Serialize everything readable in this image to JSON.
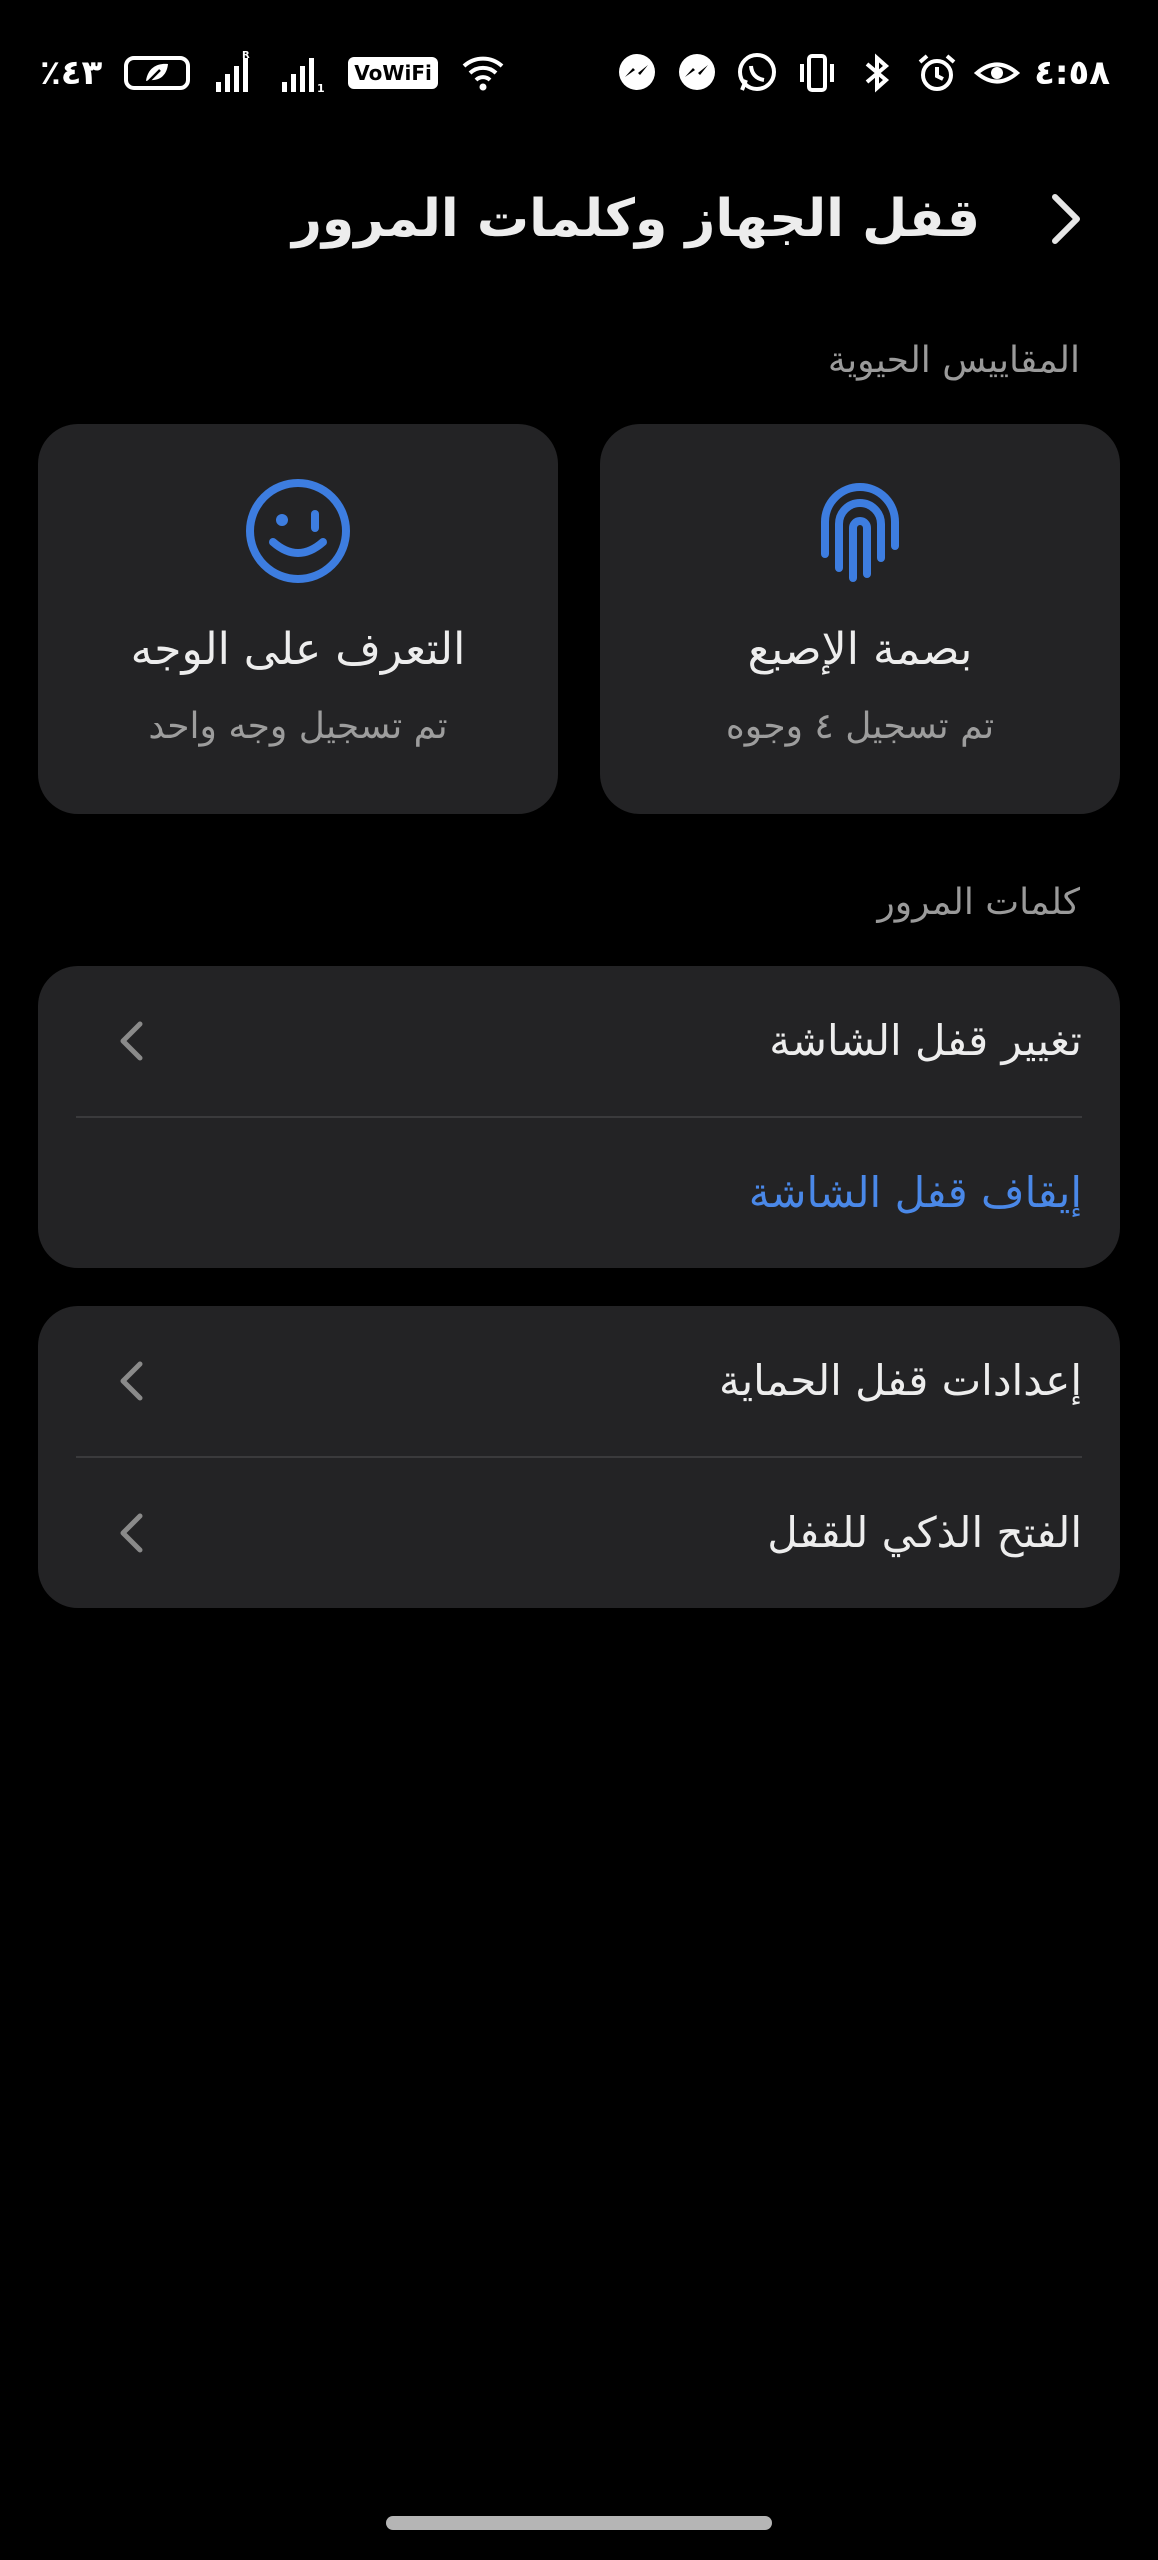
{
  "status_bar": {
    "time": "٤:٥٨",
    "battery_percent": "٪٤٣",
    "wifi_calling_label": "VoWiFi"
  },
  "header": {
    "title": "قفل الجهاز وكلمات المرور"
  },
  "biometrics": {
    "section_label": "المقاييس الحيوية",
    "fingerprint": {
      "title": "بصمة الإصبع",
      "subtitle": "تم تسجيل ٤ وجوه"
    },
    "face": {
      "title": "التعرف على الوجه",
      "subtitle": "تم تسجيل وجه واحد"
    }
  },
  "passwords": {
    "section_label": "كلمات المرور",
    "change_screen_lock": "تغيير قفل الشاشة",
    "turn_off_screen_lock": "إيقاف قفل الشاشة"
  },
  "more": {
    "protection_lock_settings": "إعدادات قفل الحماية",
    "smart_unlock": "الفتح الذكي للقفل"
  },
  "colors": {
    "background": "#000000",
    "card": "#232325",
    "accent": "#4a88e8",
    "text_primary": "#ededed",
    "text_secondary": "#9a9a9a"
  }
}
